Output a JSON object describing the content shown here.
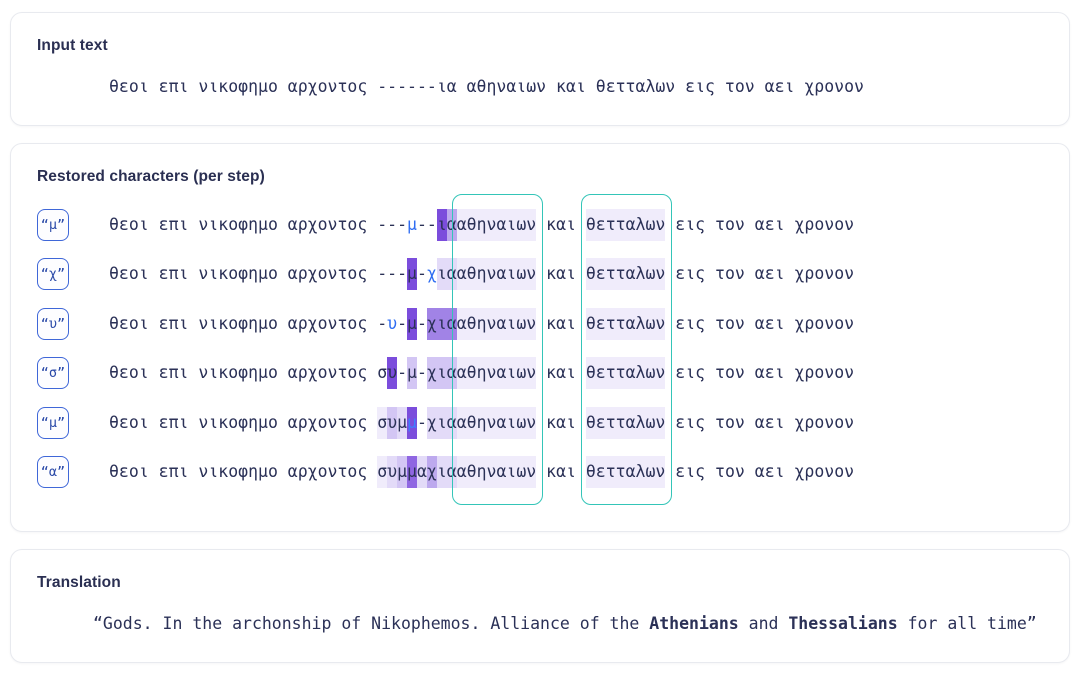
{
  "input": {
    "label": "Input text",
    "text": "θεοι επι νικοφημο αρχοντος ------ια αθηναιων και θετταλων εις τον αει χρονον"
  },
  "restored": {
    "label": "Restored characters (per step)",
    "prefix": "θεοι επι νικοφημο αρχοντος ",
    "suffix_mid": " αθηναιων και θετταλων εις τον αει χρονον",
    "steps": [
      {
        "badge": "“μ”",
        "predicted_char": "μ",
        "gap": "---μ--ια"
      },
      {
        "badge": "“χ”",
        "predicted_char": "χ",
        "gap": "---μ-χια"
      },
      {
        "badge": "“υ”",
        "predicted_char": "υ",
        "gap": "-υ-μ-χια"
      },
      {
        "badge": "“σ”",
        "predicted_char": "σ",
        "gap": "συ-μ-χια"
      },
      {
        "badge": "“μ”",
        "predicted_char": "μ",
        "gap": "συμμ-χια"
      },
      {
        "badge": "“α”",
        "predicted_char": "α",
        "gap": "συμμαχια"
      }
    ],
    "entity_boxes": [
      {
        "word": "αθηναιων"
      },
      {
        "word": "θετταλων"
      }
    ],
    "segments": {
      "row1": [
        {
          "t": "θεοι επι νικοφημο αρχοντος ",
          "h": "h0"
        },
        {
          "t": "---",
          "h": "h0"
        },
        {
          "t": "μ",
          "h": "hnew"
        },
        {
          "t": "--",
          "h": "h0"
        },
        {
          "t": "ι",
          "h": "h7"
        },
        {
          "t": "α",
          "h": "h4"
        }
      ],
      "row2": [
        {
          "t": "θεοι επι νικοφημο αρχοντος ",
          "h": "h0"
        },
        {
          "t": "---",
          "h": "h0"
        },
        {
          "t": "μ",
          "h": "h7"
        },
        {
          "t": "-",
          "h": "h0"
        },
        {
          "t": "χ",
          "h": "hnew"
        },
        {
          "t": "ια",
          "h": "h2"
        }
      ],
      "row3": [
        {
          "t": "θεοι επι νικοφημο αρχοντος ",
          "h": "h0"
        },
        {
          "t": "-",
          "h": "h0"
        },
        {
          "t": "υ",
          "h": "hnew"
        },
        {
          "t": "-",
          "h": "h0"
        },
        {
          "t": "μ",
          "h": "h7"
        },
        {
          "t": "-",
          "h": "h0"
        },
        {
          "t": "χια",
          "h": "h5"
        }
      ],
      "row4": [
        {
          "t": "θεοι επι νικοφημο αρχοντος ",
          "h": "h0"
        },
        {
          "t": "σ",
          "h": "h0"
        },
        {
          "t": "υ",
          "h": "h7"
        },
        {
          "t": "-",
          "h": "h0"
        },
        {
          "t": "μ",
          "h": "h3"
        },
        {
          "t": "-",
          "h": "h0"
        },
        {
          "t": "χια",
          "h": "h3"
        }
      ],
      "row5": [
        {
          "t": "θεοι επι νικοφημο αρχοντος ",
          "h": "h0"
        },
        {
          "t": "σ",
          "h": "h1"
        },
        {
          "t": "υ",
          "h": "h3"
        },
        {
          "t": "μ",
          "h": "h2"
        },
        {
          "t": "μ",
          "h": "hnewdark"
        },
        {
          "t": "-",
          "h": "h0"
        },
        {
          "t": "χια",
          "h": "h2"
        }
      ],
      "row6": [
        {
          "t": "θεοι επι νικοφημο αρχοντος ",
          "h": "h0"
        },
        {
          "t": "σ",
          "h": "h1"
        },
        {
          "t": "υ",
          "h": "h2"
        },
        {
          "t": "μ",
          "h": "h3"
        },
        {
          "t": "μ",
          "h": "h6"
        },
        {
          "t": "α",
          "h": "h2"
        },
        {
          "t": "χ",
          "h": "h4"
        },
        {
          "t": "ια",
          "h": "h2"
        }
      ]
    },
    "tail": [
      {
        "t": "αθηναιων",
        "h": "h1"
      },
      {
        "t": " και ",
        "h": "h0"
      },
      {
        "t": "θετταλων",
        "h": "h1"
      },
      {
        "t": " εις τον αει χρονον",
        "h": "h0"
      }
    ]
  },
  "translation": {
    "label": "Translation",
    "parts": [
      {
        "t": "“Gods. In the archonship of Nikophemos. Alliance of the ",
        "bold": false
      },
      {
        "t": "Athenians",
        "bold": true
      },
      {
        "t": " and ",
        "bold": false
      },
      {
        "t": "Thessalians",
        "bold": true
      },
      {
        "t": " for all time”",
        "bold": false
      }
    ]
  },
  "colors": {
    "text": "#2b3157",
    "badge_border": "#3f67d8",
    "entity_box": "#34c5b8",
    "highlight_strong": "#7b4ddc",
    "predicted": "#2f6df2",
    "card_border": "#e8eaef"
  }
}
